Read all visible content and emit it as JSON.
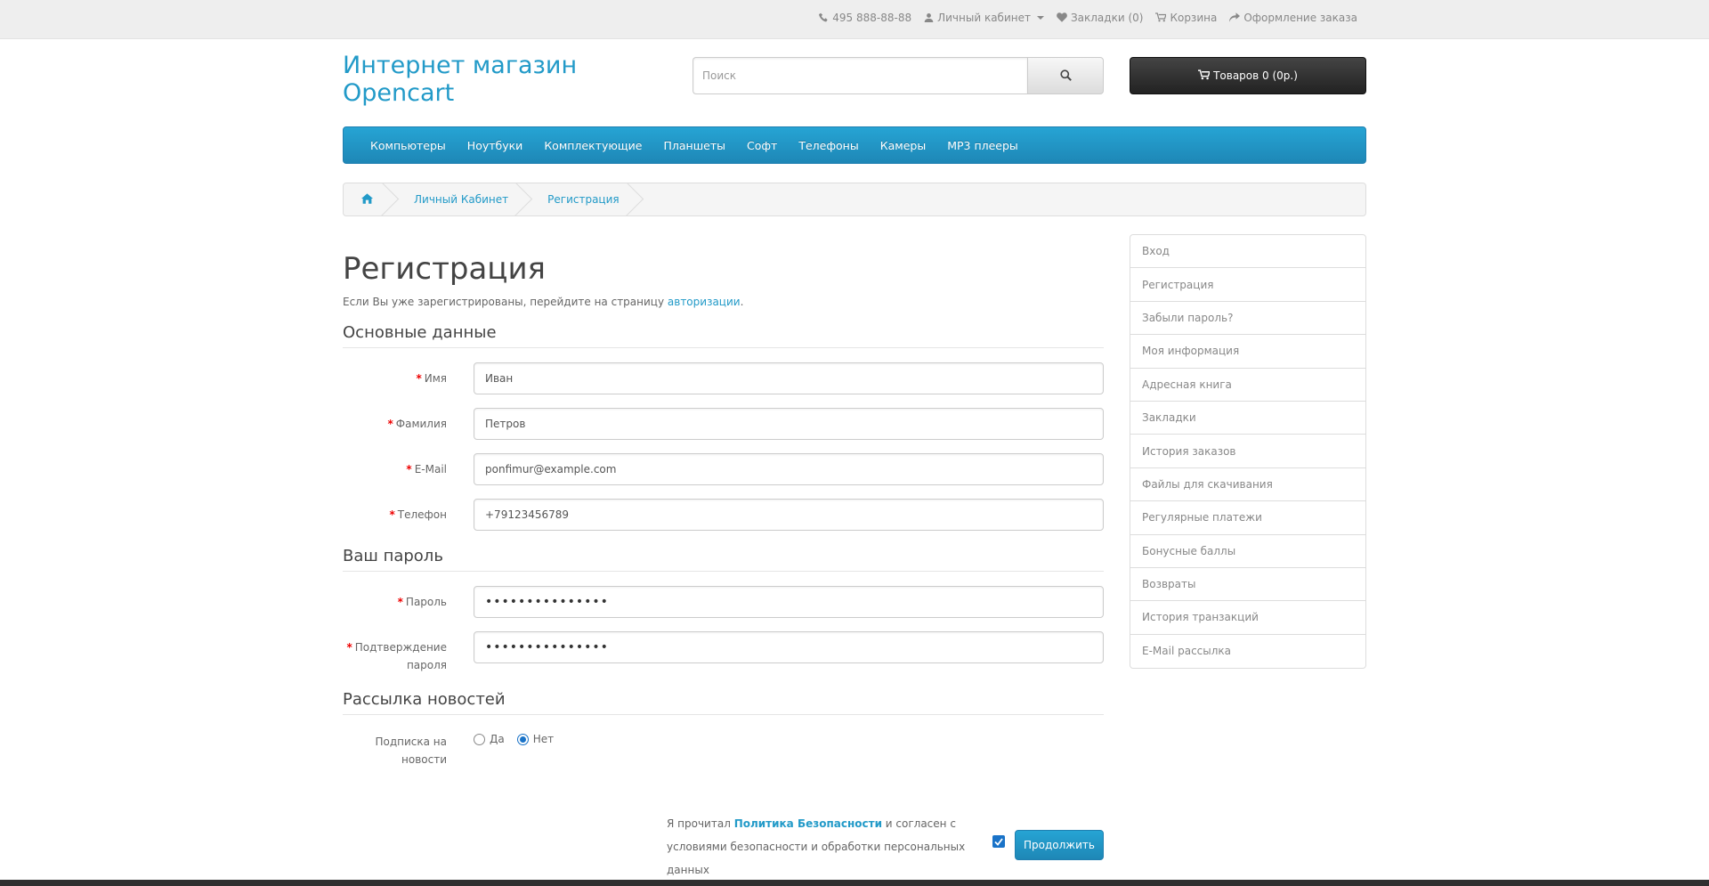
{
  "top_links": {
    "phone": "495 888-88-88",
    "account": "Личный кабинет",
    "wishlist": "Закладки (0)",
    "cart": "Корзина",
    "checkout": "Оформление заказа"
  },
  "header": {
    "logo_line1": "Интернет магазин",
    "logo_line2": "Opencart",
    "search_placeholder": "Поиск",
    "cart_button": "Товаров 0 (0р.)"
  },
  "menu": {
    "items": [
      "Компьютеры",
      "Ноутбуки",
      "Комплектующие",
      "Планшеты",
      "Софт",
      "Телефоны",
      "Камеры",
      "MP3 плееры"
    ]
  },
  "breadcrumb": {
    "items": [
      "Личный Кабинет",
      "Регистрация"
    ]
  },
  "page": {
    "title": "Регистрация",
    "intro_prefix": "Если Вы уже зарегистрированы, перейдите на страницу ",
    "intro_link": "авторизации",
    "intro_suffix": "."
  },
  "sections": {
    "personal": "Основные данные",
    "password": "Ваш пароль",
    "newsletter": "Рассылка новостей"
  },
  "fields": {
    "firstname": {
      "label": "Имя",
      "value": "Иван"
    },
    "lastname": {
      "label": "Фамилия",
      "value": "Петров"
    },
    "email": {
      "label": "E-Mail",
      "value": "ponfimur@example.com"
    },
    "telephone": {
      "label": "Телефон",
      "value": "+79123456789"
    },
    "password": {
      "label": "Пароль",
      "value": "•••••••••••••••"
    },
    "confirm": {
      "label_line1": "Подтверждение",
      "label_line2": "пароля",
      "value": "•••••••••••••••"
    }
  },
  "newsletter": {
    "label_line1": "Подписка на",
    "label_line2": "новости",
    "yes": "Да",
    "no": "Нет",
    "selected": "Нет"
  },
  "agree": {
    "prefix": "Я прочитал ",
    "link": "Политика Безопасности",
    "suffix_line1": " и согласен с",
    "line2": "условиями безопасности и обработки персональных данных",
    "checked": true
  },
  "continue_button": "Продолжить",
  "account_menu": {
    "items": [
      "Вход",
      "Регистрация",
      "Забыли пароль?",
      "Моя информация",
      "Адресная книга",
      "Закладки",
      "История заказов",
      "Файлы для скачивания",
      "Регулярные платежи",
      "Бонусные баллы",
      "Возвраты",
      "История транзакций",
      "E-Mail рассылка"
    ]
  },
  "colors": {
    "accent": "#229ac8",
    "menu_bg": "#229ac8",
    "cart_bg": "#2b2b2b",
    "required": "#e00000"
  }
}
